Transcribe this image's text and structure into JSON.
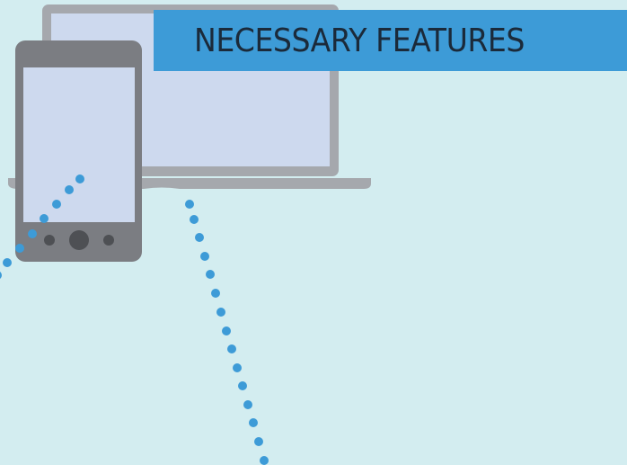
{
  "banner": {
    "title": "NECESSARY FEATURES"
  },
  "colors": {
    "background": "#d3edf0",
    "banner": "#3d9bd7",
    "title_text": "#1b2a3a",
    "device_frame": "#7b7d82",
    "laptop_frame": "#a5a8ad",
    "screen": "#cdd9ee",
    "dots": "#3d9bd7"
  },
  "icons": [
    "laptop-icon",
    "smartphone-icon"
  ]
}
